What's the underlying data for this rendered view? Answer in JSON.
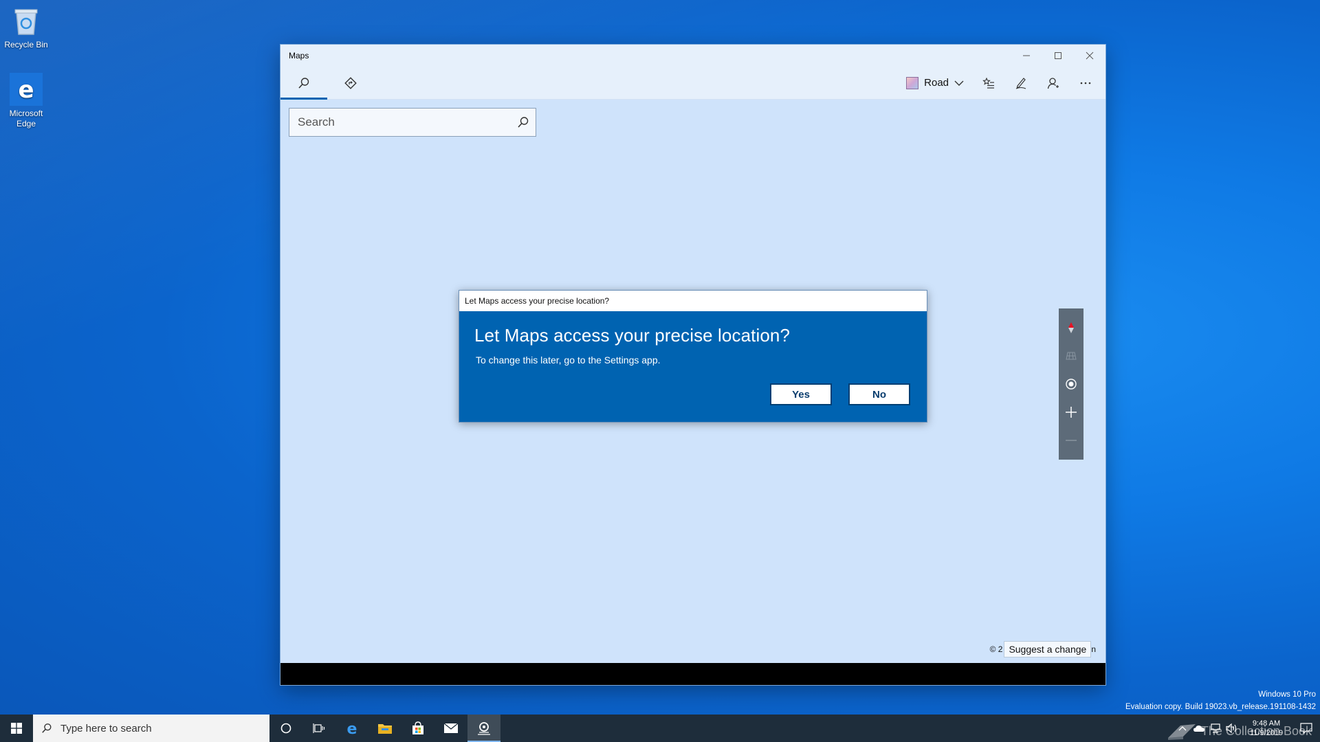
{
  "desktop": {
    "icons": [
      {
        "label": "Recycle Bin",
        "icon": "recycle-bin-icon"
      },
      {
        "label": "Microsoft Edge",
        "icon": "edge-icon"
      }
    ]
  },
  "window": {
    "title": "Maps",
    "controls": {
      "minimize": "minimize-icon",
      "maximize": "maximize-icon",
      "close": "close-icon"
    }
  },
  "toolbar": {
    "tabs": [
      {
        "name": "search",
        "icon": "search-icon",
        "active": true
      },
      {
        "name": "directions",
        "icon": "directions-icon",
        "active": false
      }
    ],
    "map_style_label": "Road",
    "tools": [
      "favorites-icon",
      "ink-icon",
      "account-icon",
      "more-icon"
    ]
  },
  "search": {
    "placeholder": "Search",
    "value": ""
  },
  "map": {
    "copyright": "© 2",
    "suggest_label": "Suggest a change",
    "suggest_trail": "n",
    "controls": [
      "compass-icon",
      "tilt-icon",
      "locate-icon",
      "zoom-in-icon",
      "zoom-out-icon"
    ]
  },
  "dialog": {
    "title": "Let Maps access your precise location?",
    "heading": "Let Maps access your precise location?",
    "message": "To change this later, go to the Settings app.",
    "yes_label": "Yes",
    "no_label": "No"
  },
  "taskbar": {
    "search_placeholder": "Type here to search",
    "apps": [
      "cortana-icon",
      "task-view-icon",
      "edge-icon",
      "file-explorer-icon",
      "store-icon",
      "mail-icon",
      "maps-icon"
    ],
    "clock_time": "9:48 AM",
    "clock_date": "11/9/2019"
  },
  "watermark": {
    "line1": "Windows 10 Pro",
    "line2": "Evaluation copy. Build 19023.vb_release.191108-1432",
    "site": "The Collection Book"
  },
  "colors": {
    "accent": "#0063b1",
    "taskbar": "#1e2d3b",
    "map_bg": "#cfe3fb"
  }
}
